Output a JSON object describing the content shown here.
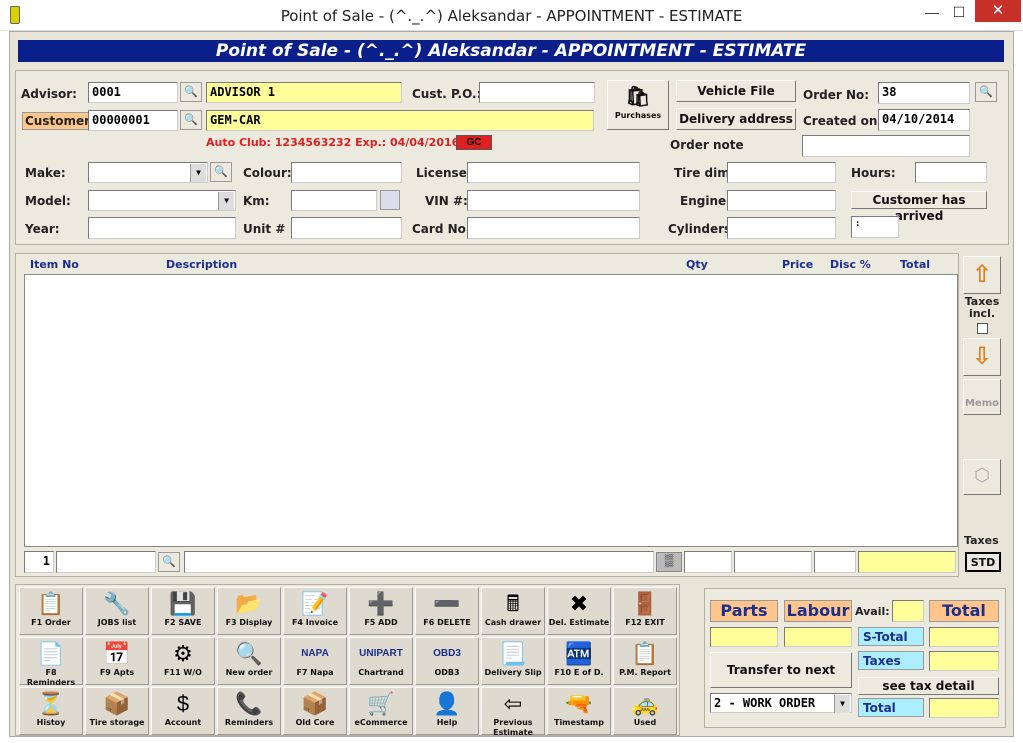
{
  "window": {
    "title": "Point of Sale - (^._.^) Aleksandar - APPOINTMENT - ESTIMATE",
    "minimize": "—",
    "maximize": "☐",
    "close": "✕"
  },
  "banner": "Point of Sale - (^._.^) Aleksandar - APPOINTMENT - ESTIMATE",
  "header": {
    "advisor_label": "Advisor:",
    "advisor_code": "0001",
    "advisor_name": "ADVISOR 1",
    "customer_label": "Customer:",
    "customer_code": "00000001",
    "customer_name": "GEM-CAR",
    "custpo_label": "Cust. P.O.:",
    "custpo_value": "",
    "purchases_label": "Purchases",
    "vehicle_file": "Vehicle File",
    "delivery_address": "Delivery address",
    "order_no_label": "Order No:",
    "order_no": "38",
    "created_on_label": "Created on:",
    "created_on": "04/10/2014",
    "order_note_label": "Order note",
    "auto_club": "Auto Club: 1234563232  Exp.: 04/04/2016",
    "gc_badge": "GC"
  },
  "vehicle": {
    "make_label": "Make:",
    "model_label": "Model:",
    "year_label": "Year:",
    "colour_label": "Colour:",
    "km_label": "Km:",
    "unit_label": "Unit #",
    "license_label": "License:",
    "vin_label": "VIN #:",
    "card_label": "Card No:",
    "tire_label": "Tire dim.",
    "engine_label": "Engine:",
    "cylinders_label": "Cylinders:",
    "hours_label": "Hours:",
    "customer_arrived": "Customer has arrived",
    "time_value": ":"
  },
  "grid": {
    "columns": [
      "Item No",
      "Description",
      "Qty",
      "Price",
      "Disc %",
      "Total"
    ],
    "line_no": "1"
  },
  "side": {
    "taxes_incl": "Taxes incl.",
    "memo": "Memo",
    "taxes": "Taxes",
    "std": "STD"
  },
  "tiles": [
    {
      "label": "F1 Order",
      "icon": "order-icon",
      "glyph": "📋"
    },
    {
      "label": "JOBS list",
      "icon": "jobs-icon",
      "glyph": "🔧"
    },
    {
      "label": "F2 SAVE",
      "icon": "save-icon",
      "glyph": "💾"
    },
    {
      "label": "F3 Display",
      "icon": "display-icon",
      "glyph": "📂"
    },
    {
      "label": "F4 Invoice",
      "icon": "invoice-icon",
      "glyph": "📝"
    },
    {
      "label": "F5 ADD",
      "icon": "add-icon",
      "glyph": "➕"
    },
    {
      "label": "F6 DELETE",
      "icon": "delete-icon",
      "glyph": "➖"
    },
    {
      "label": "Cash drawer",
      "icon": "cash-drawer-icon",
      "glyph": "🖩"
    },
    {
      "label": "Del. Estimate",
      "icon": "del-estimate-icon",
      "glyph": "✖"
    },
    {
      "label": "F12 EXIT",
      "icon": "exit-icon",
      "glyph": "🚪"
    },
    {
      "label": "F8 Reminders",
      "icon": "reminders-icon",
      "glyph": "📄"
    },
    {
      "label": "F9 Apts",
      "icon": "calendar-icon",
      "glyph": "📅"
    },
    {
      "label": "F11 W/O",
      "icon": "work-order-icon",
      "glyph": "⚙"
    },
    {
      "label": "New order",
      "icon": "new-order-icon",
      "glyph": "🔍"
    },
    {
      "label": "F7 Napa",
      "icon": "napa-icon",
      "glyph": "NAPA"
    },
    {
      "label": "Chartrand",
      "icon": "unipart-icon",
      "glyph": "UNIPART"
    },
    {
      "label": "ODB3",
      "icon": "obd3-icon",
      "glyph": "OBD3"
    },
    {
      "label": "Delivery Slip",
      "icon": "delivery-slip-icon",
      "glyph": "📃"
    },
    {
      "label": "F10 E of D.",
      "icon": "end-of-day-icon",
      "glyph": "🏧"
    },
    {
      "label": "P.M. Report",
      "icon": "pm-report-icon",
      "glyph": "📋"
    },
    {
      "label": "Histoy",
      "icon": "history-icon",
      "glyph": "⏳"
    },
    {
      "label": "Tire storage",
      "icon": "tire-storage-icon",
      "glyph": "📦"
    },
    {
      "label": "Account",
      "icon": "account-icon",
      "glyph": "$"
    },
    {
      "label": "Reminders",
      "icon": "reminders-phone-icon",
      "glyph": "📞"
    },
    {
      "label": "Old Core",
      "icon": "old-core-icon",
      "glyph": "📦"
    },
    {
      "label": "eCommerce",
      "icon": "ecommerce-icon",
      "glyph": "🛒"
    },
    {
      "label": "Help",
      "icon": "help-icon",
      "glyph": "👤"
    },
    {
      "label": "Previous Estimate",
      "icon": "previous-icon",
      "glyph": "⇦"
    },
    {
      "label": "Timestamp",
      "icon": "scanner-icon",
      "glyph": "🔫"
    },
    {
      "label": "Used",
      "icon": "used-icon",
      "glyph": "🚕"
    }
  ],
  "totals": {
    "parts": "Parts",
    "labour": "Labour",
    "avail": "Avail:",
    "total_hdr": "Total",
    "s_total": "S-Total",
    "taxes": "Taxes",
    "total": "Total",
    "transfer": "Transfer to next step.",
    "see_tax": "see tax detail",
    "work_order": "2 - WORK ORDER"
  },
  "colors": {
    "banner": "#0b1f8a",
    "yellow": "#ffff99",
    "orange": "#ffc58a",
    "cyan": "#aaeeff",
    "red": "#e02020"
  }
}
